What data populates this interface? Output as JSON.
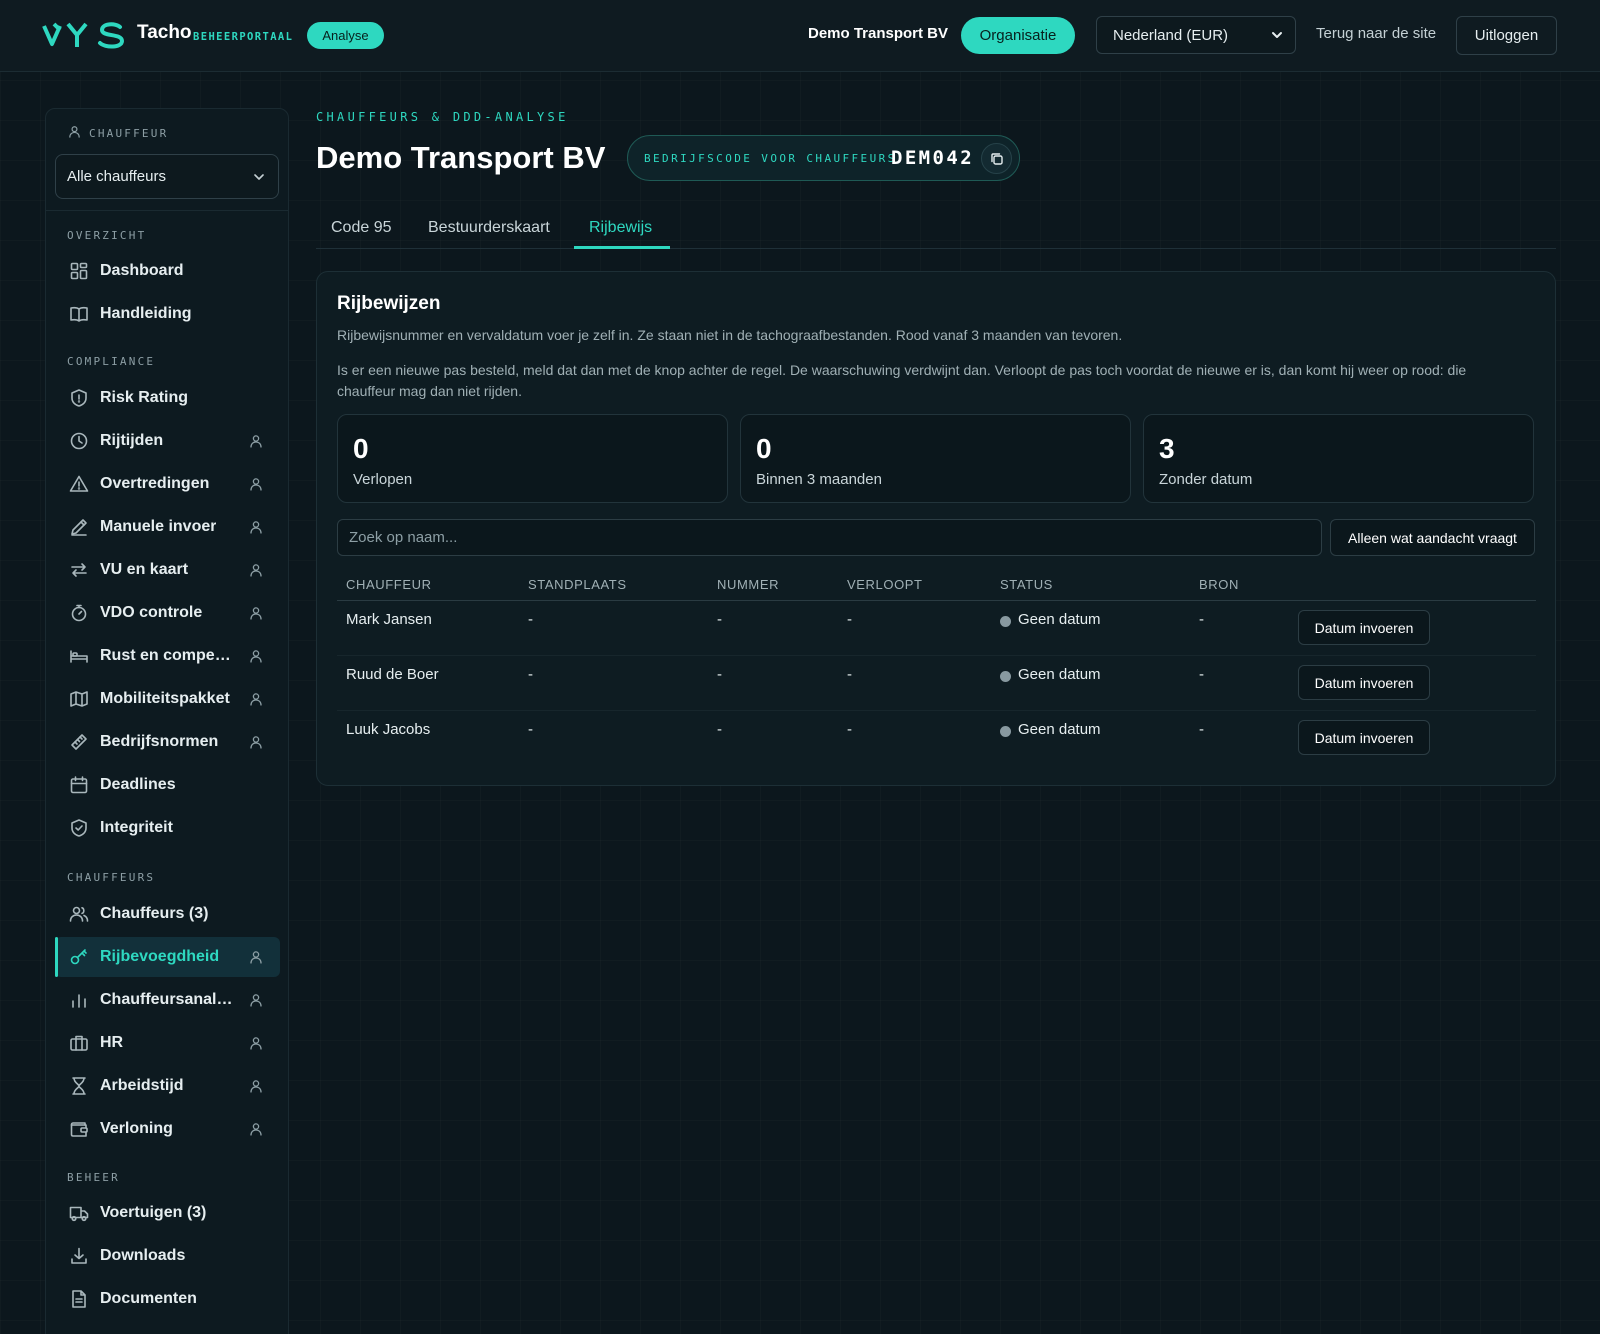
{
  "header": {
    "brand_name": "Tacho",
    "brand_sub": "BEHEERPORTAAL",
    "badge": "Analyse",
    "org_name": "Demo Transport BV",
    "org_button": "Organisatie",
    "country_select": "Nederland (EUR)",
    "back_link": "Terug naar de site",
    "logout": "Uitloggen"
  },
  "sidebar": {
    "chauffeur_label": "CHAUFFEUR",
    "chauffeur_select": "Alle chauffeurs",
    "sections": [
      {
        "label": "OVERZICHT",
        "items": [
          {
            "label": "Dashboard",
            "icon": "grid-icon",
            "per_driver": false
          },
          {
            "label": "Handleiding",
            "icon": "book-icon",
            "per_driver": false
          }
        ]
      },
      {
        "label": "COMPLIANCE",
        "items": [
          {
            "label": "Risk Rating",
            "icon": "shield-icon",
            "per_driver": false
          },
          {
            "label": "Rijtijden",
            "icon": "clock-icon",
            "per_driver": true
          },
          {
            "label": "Overtredingen",
            "icon": "warning-icon",
            "per_driver": true
          },
          {
            "label": "Manuele invoer",
            "icon": "pencil-icon",
            "per_driver": true
          },
          {
            "label": "VU en kaart",
            "icon": "transfer-icon",
            "per_driver": true
          },
          {
            "label": "VDO controle",
            "icon": "stopwatch-icon",
            "per_driver": true
          },
          {
            "label": "Rust en compensatie",
            "icon": "bed-icon",
            "per_driver": true
          },
          {
            "label": "Mobiliteitspakket",
            "icon": "map-icon",
            "per_driver": true
          },
          {
            "label": "Bedrijfsnormen",
            "icon": "ruler-icon",
            "per_driver": true
          },
          {
            "label": "Deadlines",
            "icon": "calendar-icon",
            "per_driver": false
          },
          {
            "label": "Integriteit",
            "icon": "shield-check-icon",
            "per_driver": false
          }
        ]
      },
      {
        "label": "CHAUFFEURS",
        "items": [
          {
            "label": "Chauffeurs (3)",
            "icon": "users-icon",
            "per_driver": false
          },
          {
            "label": "Rijbevoegdheid",
            "icon": "key-icon",
            "per_driver": true,
            "active": true
          },
          {
            "label": "Chauffeursanalyse",
            "icon": "bar-chart-icon",
            "per_driver": true
          },
          {
            "label": "HR",
            "icon": "briefcase-icon",
            "per_driver": true
          },
          {
            "label": "Arbeidstijd",
            "icon": "hourglass-icon",
            "per_driver": true
          },
          {
            "label": "Verloning",
            "icon": "wallet-icon",
            "per_driver": true
          }
        ]
      },
      {
        "label": "BEHEER",
        "items": [
          {
            "label": "Voertuigen (3)",
            "icon": "truck-icon",
            "per_driver": false
          },
          {
            "label": "Downloads",
            "icon": "download-icon",
            "per_driver": false
          },
          {
            "label": "Documenten",
            "icon": "document-icon",
            "per_driver": false
          }
        ]
      }
    ]
  },
  "page": {
    "eyebrow": "CHAUFFEURS & DDD-ANALYSE",
    "title": "Demo Transport BV",
    "company_code_label": "BEDRIJFSCODE VOOR CHAUFFEURS",
    "company_code": "DEM042",
    "tabs": [
      {
        "label": "Code 95"
      },
      {
        "label": "Bestuurderskaart"
      },
      {
        "label": "Rijbewijs",
        "active": true
      }
    ]
  },
  "card": {
    "title": "Rijbewijzen",
    "description": "Rijbewijsnummer en vervaldatum voer je zelf in. Ze staan niet in de tachograafbestanden. Rood vanaf 3 maanden van tevoren.",
    "description2": "Is er een nieuwe pas besteld, meld dat dan met de knop achter de regel. De waarschuwing verdwijnt dan. Verloopt de pas toch voordat de nieuwe er is, dan komt hij weer op rood: die chauffeur mag dan niet rijden.",
    "stats": [
      {
        "value": "0",
        "label": "Verlopen"
      },
      {
        "value": "0",
        "label": "Binnen 3 maanden"
      },
      {
        "value": "3",
        "label": "Zonder datum"
      }
    ],
    "search_placeholder": "Zoek op naam...",
    "attention_button": "Alleen wat aandacht vraagt",
    "columns": [
      "CHAUFFEUR",
      "STANDPLAATS",
      "NUMMER",
      "VERLOOPT",
      "STATUS",
      "BRON"
    ],
    "rows": [
      {
        "chauffeur": "Mark Jansen",
        "standplaats": "-",
        "nummer": "-",
        "verloopt": "-",
        "status": "Geen datum",
        "bron": "-",
        "action": "Datum invoeren"
      },
      {
        "chauffeur": "Ruud de Boer",
        "standplaats": "-",
        "nummer": "-",
        "verloopt": "-",
        "status": "Geen datum",
        "bron": "-",
        "action": "Datum invoeren"
      },
      {
        "chauffeur": "Luuk Jacobs",
        "standplaats": "-",
        "nummer": "-",
        "verloopt": "-",
        "status": "Geen datum",
        "bron": "-",
        "action": "Datum invoeren"
      }
    ]
  },
  "colors": {
    "accent": "#2ed8c0",
    "background": "#0c171d",
    "status_neutral": "#8899a0"
  }
}
